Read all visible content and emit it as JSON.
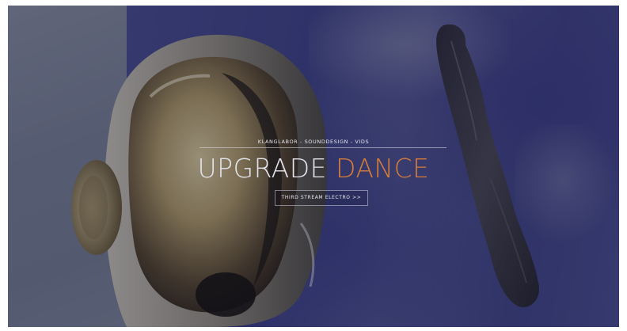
{
  "hero": {
    "tagline": "KLANGLABOR - SOUNDDESIGN - VIDS",
    "title_word1": "UPGRADE",
    "title_word2": "DANCE",
    "cta_label": "THIRD STREAM ELECTRO >>"
  },
  "colors": {
    "title_primary": "#e4e4ec",
    "title_accent": "#d67c3a",
    "paint_blue": "#3f4590",
    "overlay": "rgba(20,22,40,0.38)"
  },
  "images": {
    "background": "chrome-helmet-on-blue-paint-photo"
  }
}
